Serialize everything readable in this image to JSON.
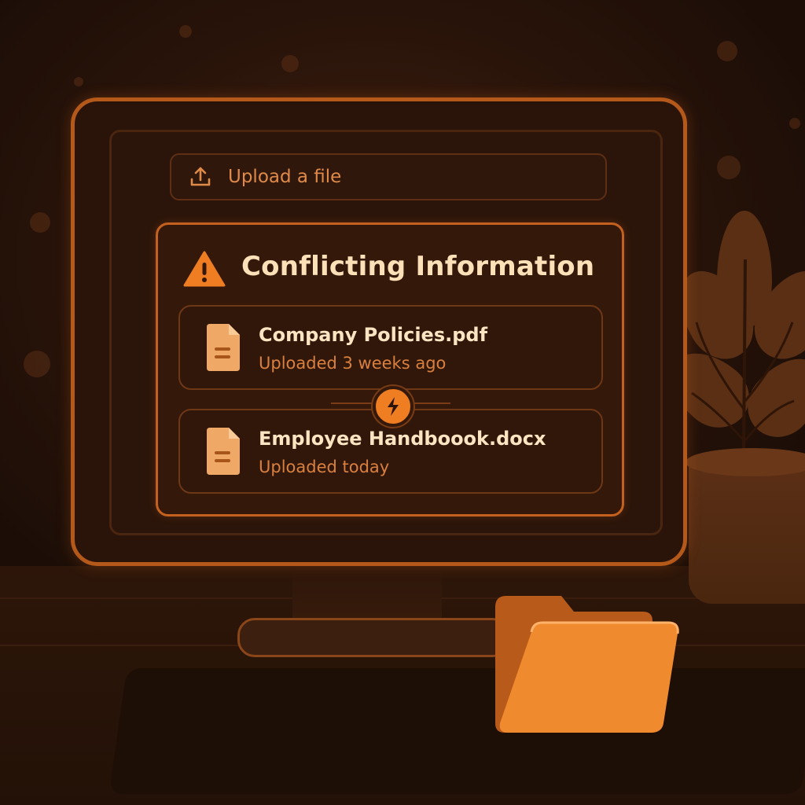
{
  "upload": {
    "label": "Upload a file",
    "icon": "upload-icon"
  },
  "conflict": {
    "title": "Conflicting Information",
    "icon": "warning-icon",
    "files": [
      {
        "name": "Company Policies.pdf",
        "meta": "Uploaded 3 weeks ago",
        "icon": "document-icon"
      },
      {
        "name": "Employee Handboook.docx",
        "meta": "Uploaded today",
        "icon": "document-icon"
      }
    ],
    "connector_icon": "lightning-bolt-icon"
  },
  "colors": {
    "accent": "#ef7d22",
    "monitor_border": "#b4591a",
    "panel_border": "#c4611e",
    "title_text": "#fbe0b8",
    "meta_text": "#d9803f",
    "background": "#2a140a"
  }
}
